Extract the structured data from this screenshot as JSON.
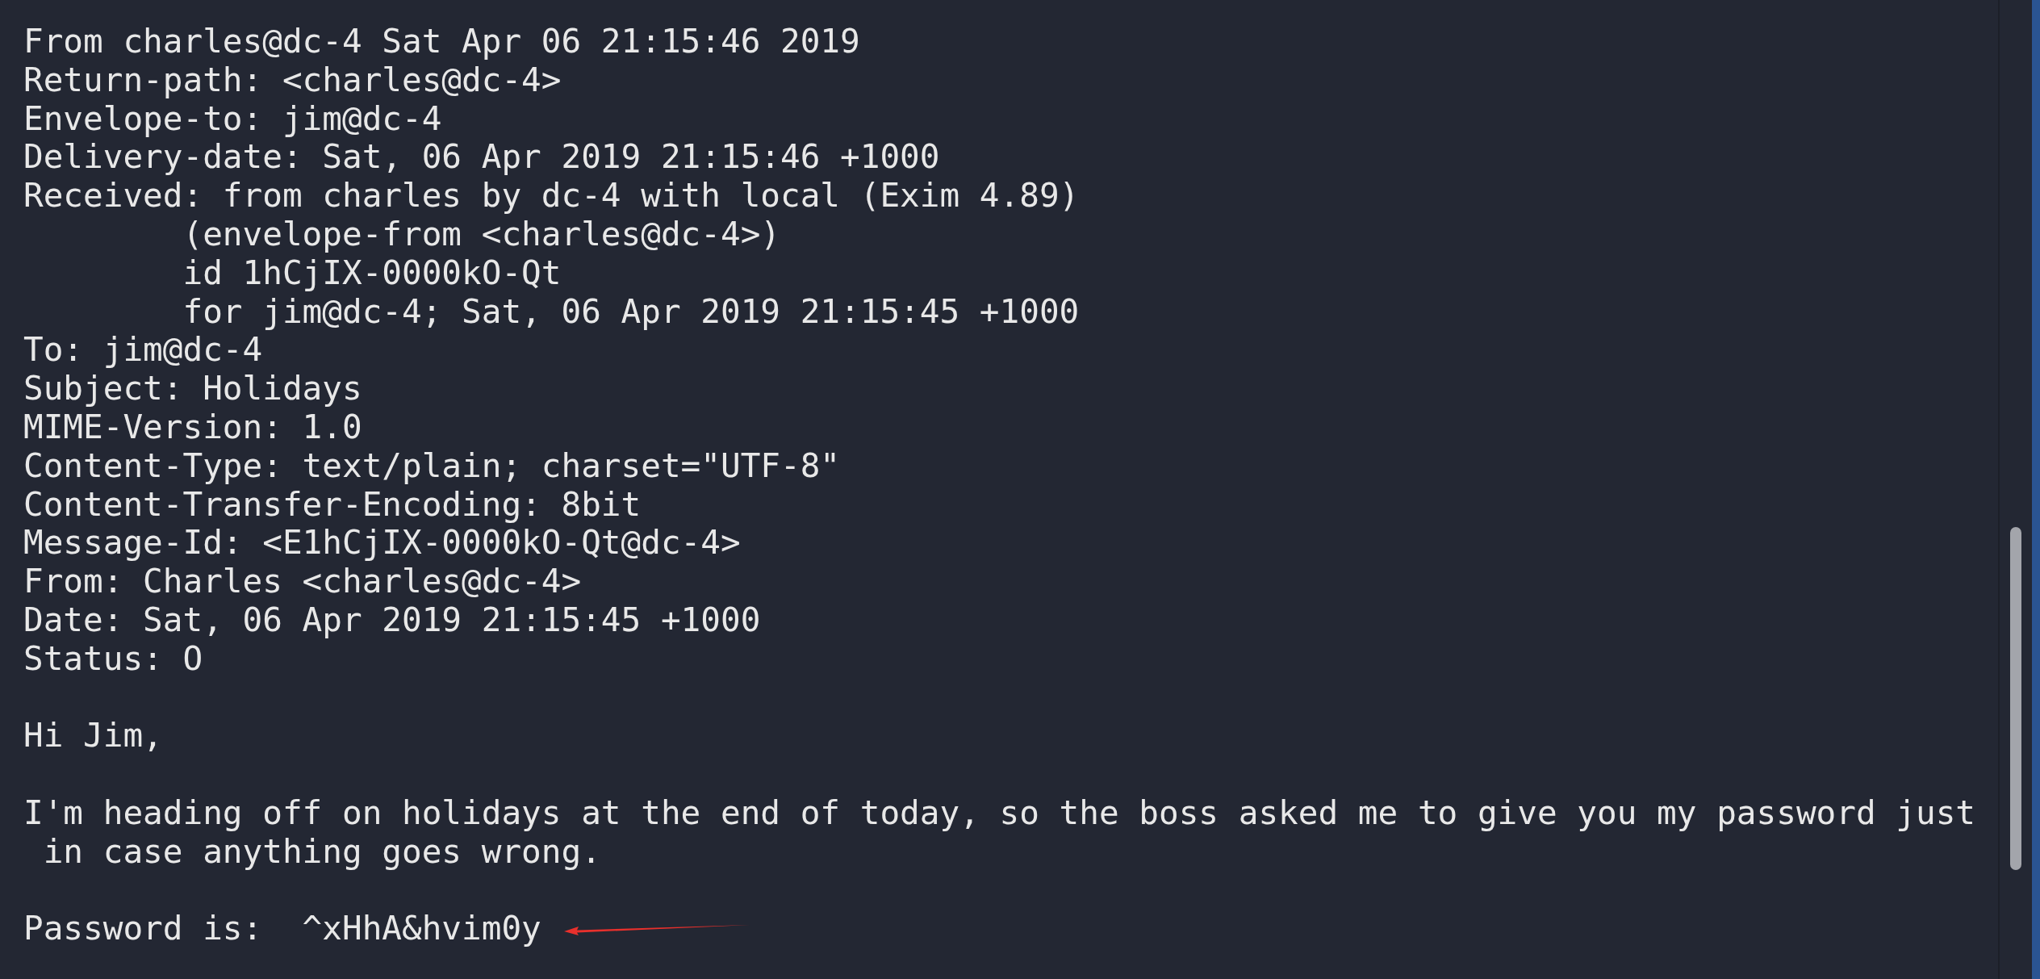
{
  "headers": [
    "From charles@dc-4 Sat Apr 06 21:15:46 2019",
    "Return-path: <charles@dc-4>",
    "Envelope-to: jim@dc-4",
    "Delivery-date: Sat, 06 Apr 2019 21:15:46 +1000",
    "Received: from charles by dc-4 with local (Exim 4.89)",
    "        (envelope-from <charles@dc-4>)",
    "        id 1hCjIX-0000kO-Qt",
    "        for jim@dc-4; Sat, 06 Apr 2019 21:15:45 +1000",
    "To: jim@dc-4",
    "Subject: Holidays",
    "MIME-Version: 1.0",
    "Content-Type: text/plain; charset=\"UTF-8\"",
    "Content-Transfer-Encoding: 8bit",
    "Message-Id: <E1hCjIX-0000kO-Qt@dc-4>",
    "From: Charles <charles@dc-4>",
    "Date: Sat, 06 Apr 2019 21:15:45 +1000",
    "Status: O"
  ],
  "body": [
    [
      "Hi Jim,"
    ],
    [
      "I'm heading off on holidays at the end of today, so the boss asked me to give you my password just",
      " in case anything goes wrong."
    ],
    [
      "Password is:  ^xHhA&hvim0y"
    ]
  ],
  "annotation": {
    "kind": "arrow",
    "color": "#e8302c"
  }
}
